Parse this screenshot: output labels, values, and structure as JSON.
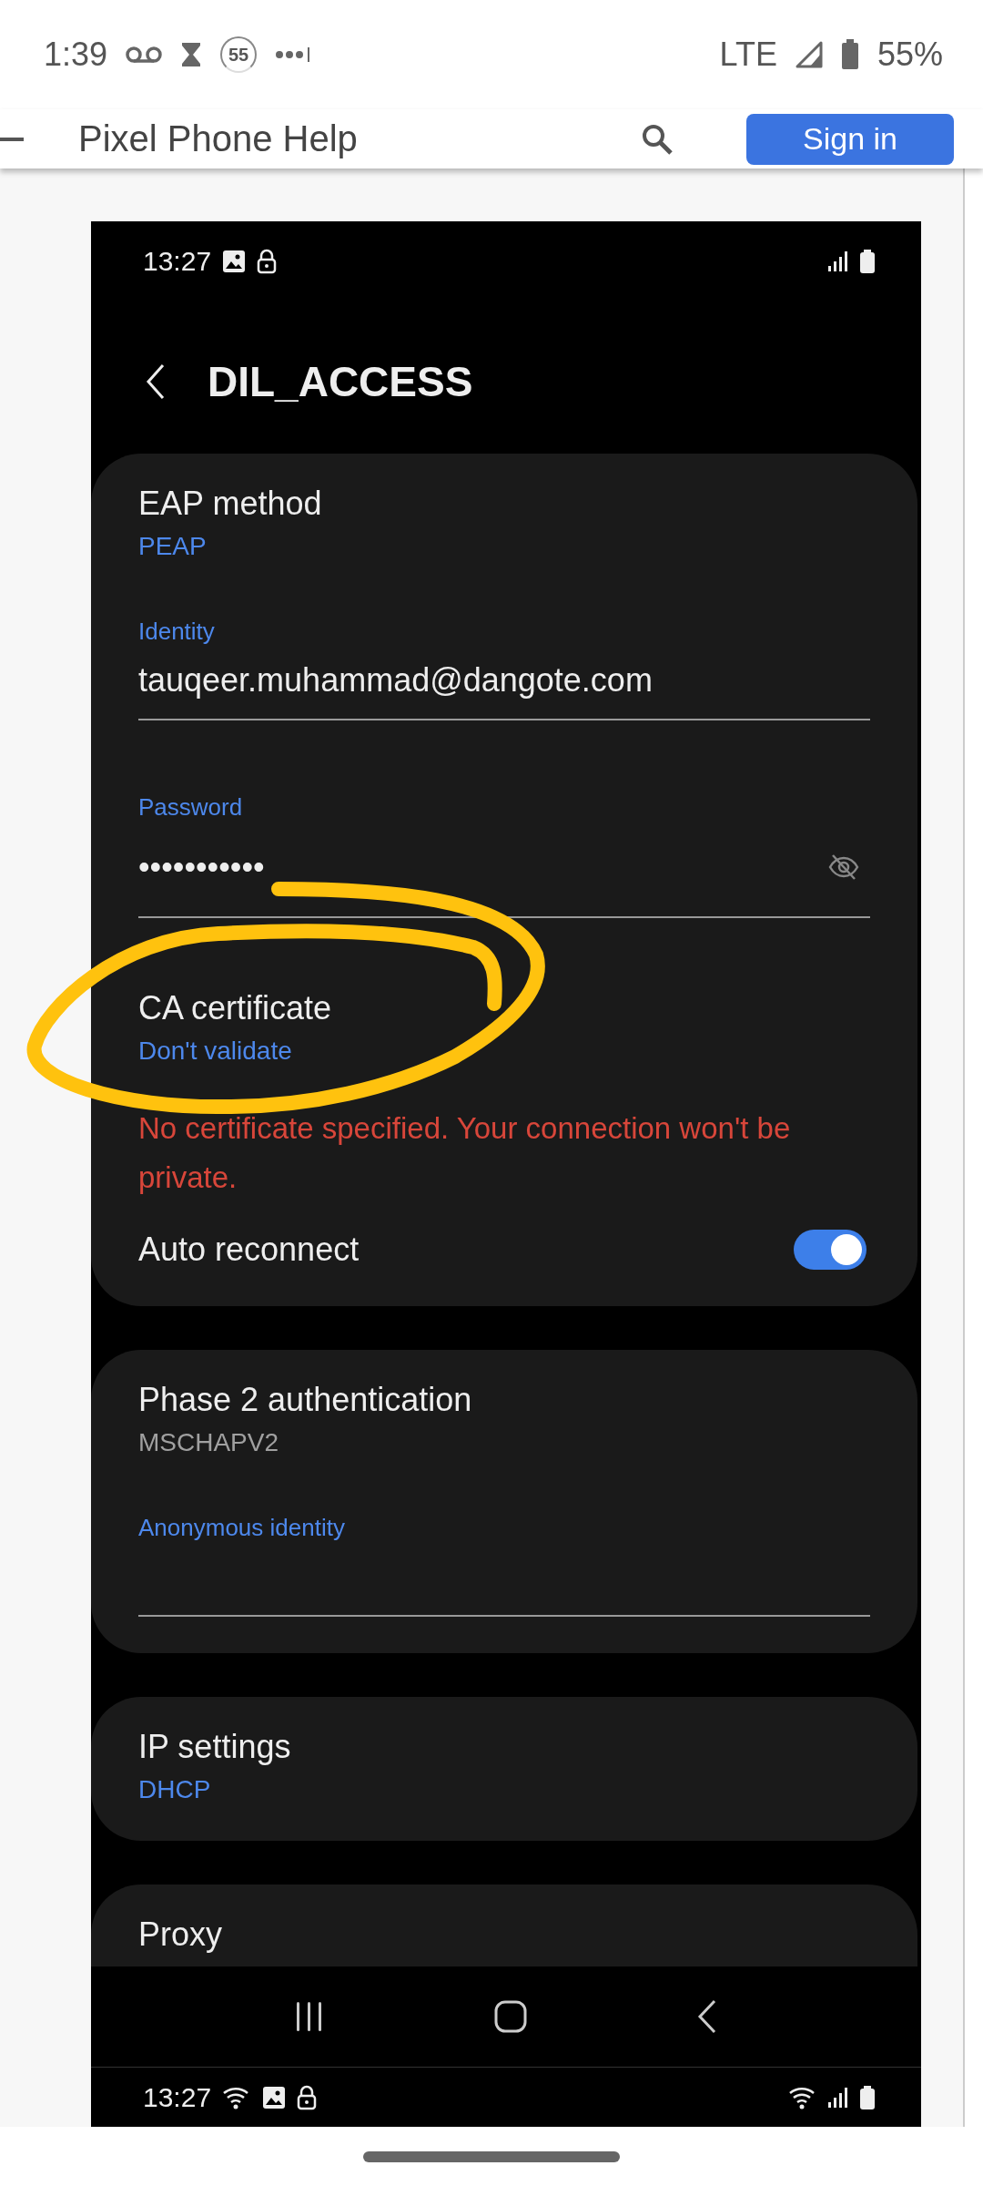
{
  "status_bar": {
    "time": "1:39",
    "data_saver": "55",
    "network": "LTE",
    "battery": "55%"
  },
  "web_header": {
    "title": "Pixel Phone Help",
    "button": "Sign in"
  },
  "inner_screen": {
    "status_time": "13:27",
    "title": "DIL_ACCESS",
    "cards": [
      {
        "items": [
          {
            "kind": "setting",
            "title": "EAP method",
            "value": "PEAP",
            "accent": true
          },
          {
            "kind": "field",
            "label": "Identity",
            "value": "tauqeer.muhammad@dangote.com"
          },
          {
            "kind": "password",
            "label": "Password",
            "value": "•••••••••••",
            "revealed": false
          },
          {
            "kind": "setting",
            "title": "CA certificate",
            "value": "Don't validate",
            "accent": true
          },
          {
            "kind": "warning",
            "text": "No certificate specified. Your connection won't be private."
          },
          {
            "kind": "toggle",
            "title": "Auto reconnect",
            "on": true
          }
        ]
      },
      {
        "items": [
          {
            "kind": "setting",
            "title": "Phase 2 authentication",
            "value": "MSCHAPV2",
            "accent": false
          },
          {
            "kind": "field",
            "label": "Anonymous identity"
          }
        ]
      },
      {
        "items": [
          {
            "kind": "setting",
            "title": "IP settings",
            "value": "DHCP",
            "accent": true
          }
        ]
      },
      {
        "items": [
          {
            "kind": "cut",
            "title": "Proxy"
          }
        ]
      }
    ],
    "bottom_status_time": "13:27"
  }
}
